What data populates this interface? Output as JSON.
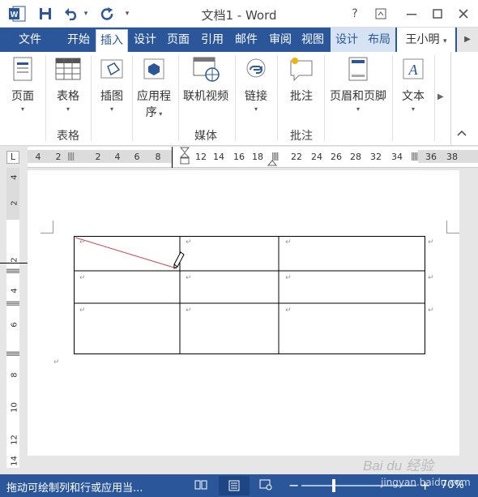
{
  "window": {
    "title": "文档1 - Word",
    "help": "?"
  },
  "tabs": [
    {
      "label": "文件"
    },
    {
      "label": "开始"
    },
    {
      "label": "插入"
    },
    {
      "label": "设计"
    },
    {
      "label": "页面"
    },
    {
      "label": "引用"
    },
    {
      "label": "邮件"
    },
    {
      "label": "审阅"
    },
    {
      "label": "视图"
    },
    {
      "label": "设计"
    },
    {
      "label": "布局"
    }
  ],
  "user": {
    "name": "王小明"
  },
  "ribbon": {
    "page": "页面",
    "table": "表格",
    "picture": "插图",
    "apps_line1": "应用程",
    "apps_line2": "序",
    "online_video": "联机视频",
    "link": "链接",
    "comment": "批注",
    "header_footer": "页眉和页脚",
    "text": "文本",
    "group_table": "表格",
    "group_media": "媒体",
    "group_comments": "批注"
  },
  "ruler": {
    "corner": "L",
    "ticks": [
      "4",
      "2",
      "2",
      "4",
      "6",
      "8",
      "12",
      "14",
      "16",
      "18",
      "22",
      "24",
      "26",
      "28",
      "32",
      "34",
      "36",
      "38"
    ],
    "vticks": [
      "4",
      "2",
      "2",
      "4",
      "6",
      "8",
      "10",
      "12",
      "14"
    ]
  },
  "status": {
    "text": "拖动可绘制列和行或应用当...",
    "zoom": "70%"
  },
  "watermark": {
    "line1": "Bai du 经验",
    "line2": "jingyan.baidu.com"
  }
}
